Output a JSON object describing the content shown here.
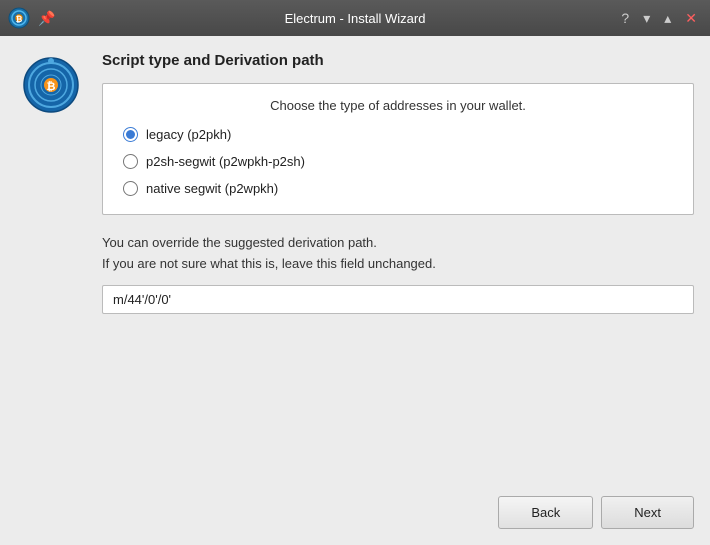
{
  "titlebar": {
    "title": "Electrum - Install Wizard",
    "help_icon": "?",
    "chevron_down_icon": "▾",
    "chevron_up_icon": "▴",
    "close_icon": "✕"
  },
  "section": {
    "title": "Script type and Derivation path",
    "subtitle": "Choose the type of addresses in your wallet.",
    "options": [
      {
        "id": "legacy",
        "label": "legacy (p2pkh)",
        "checked": true
      },
      {
        "id": "p2sh-segwit",
        "label": "p2sh-segwit (p2wpkh-p2sh)",
        "checked": false
      },
      {
        "id": "native-segwit",
        "label": "native segwit (p2wpkh)",
        "checked": false
      }
    ],
    "override_line1": "You can override the suggested derivation path.",
    "override_line2": "If you are not sure what this is, leave this field unchanged.",
    "derivation_path_value": "m/44'/0'/0'"
  },
  "footer": {
    "back_label": "Back",
    "next_label": "Next"
  }
}
